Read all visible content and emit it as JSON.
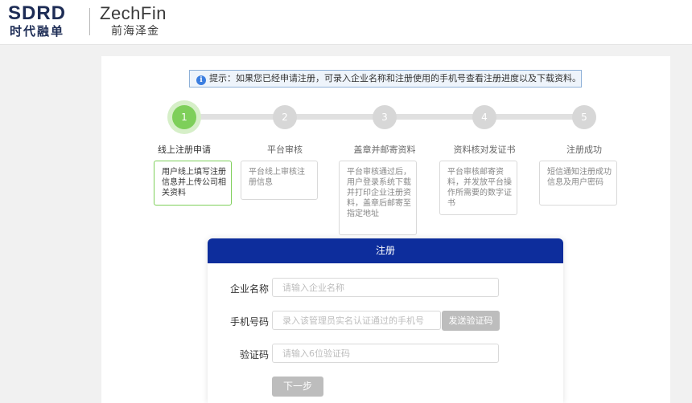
{
  "header": {
    "logo_sdrd_en": "SDRD",
    "logo_sdrd_cn": "时代融单",
    "logo_zf_en": "ZechFin",
    "logo_zf_cn": "前海泽金"
  },
  "tip": {
    "text": "提示：如果您已经申请注册，可录入企业名称和注册使用的手机号查看注册进度以及下载资料。",
    "icon": "info-icon",
    "icon_glyph": "i"
  },
  "steps": [
    {
      "num": "1",
      "title": "线上注册申请",
      "desc": "用户线上填写注册信息并上传公司相关资料",
      "active": true
    },
    {
      "num": "2",
      "title": "平台审核",
      "desc": "平台线上审核注册信息",
      "active": false
    },
    {
      "num": "3",
      "title": "盖章并邮寄资料",
      "desc": "平台审核通过后，用户登录系统下载并打印企业注册资料，盖章后邮寄至指定地址",
      "active": false
    },
    {
      "num": "4",
      "title": "资料核对发证书",
      "desc": "平台审核邮寄资料，并发放平台操作所需要的数字证书",
      "active": false
    },
    {
      "num": "5",
      "title": "注册成功",
      "desc": "短信通知注册成功信息及用户密码",
      "active": false
    }
  ],
  "form": {
    "title": "注册",
    "company_label": "企业名称",
    "company_placeholder": "请输入企业名称",
    "phone_label": "手机号码",
    "phone_placeholder": "录入该管理员实名认证通过的手机号",
    "send_code_label": "发送验证码",
    "code_label": "验证码",
    "code_placeholder": "请输入6位验证码",
    "next_label": "下一步"
  },
  "colors": {
    "accent_green": "#7ecf5a",
    "header_blue": "#0d2d9c",
    "disabled_gray": "#bdbdbd"
  }
}
